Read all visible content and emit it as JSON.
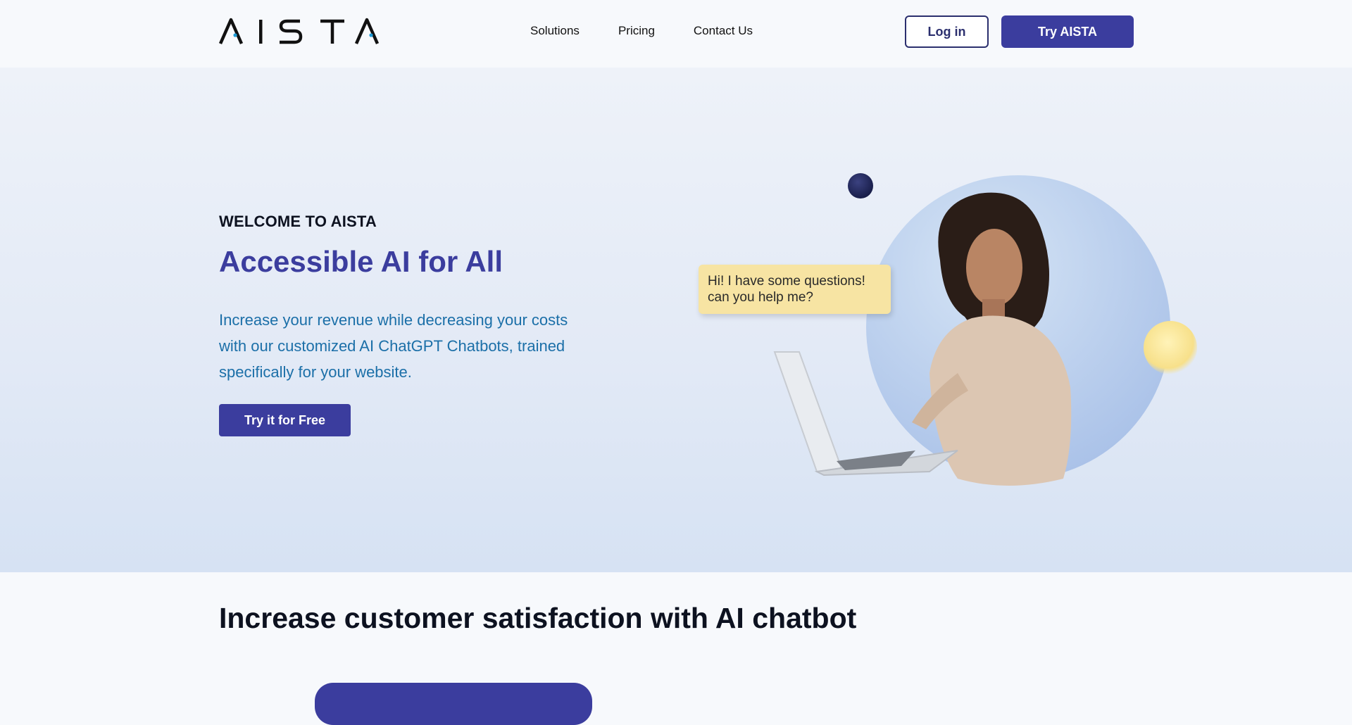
{
  "brand": {
    "logo_text": "AISTA"
  },
  "nav": {
    "items": [
      "Solutions",
      "Pricing",
      "Contact Us"
    ]
  },
  "header": {
    "login_label": "Log in",
    "try_label": "Try AISTA"
  },
  "hero": {
    "eyebrow": "WELCOME TO AISTA",
    "title": "Accessible AI for All",
    "description": "Increase your revenue while decreasing your costs with our customized AI ChatGPT Chatbots, trained specifically for your website.",
    "cta_label": "Try it for Free",
    "chat_bubble_line1": "Hi! I have some questions!",
    "chat_bubble_line2": "can you help me?"
  },
  "section2": {
    "title": "Increase customer satisfaction with AI chatbot"
  },
  "colors": {
    "primary": "#3b3d9e",
    "accent_blue": "#1b6fa8",
    "bubble": "#f7e4a3"
  }
}
